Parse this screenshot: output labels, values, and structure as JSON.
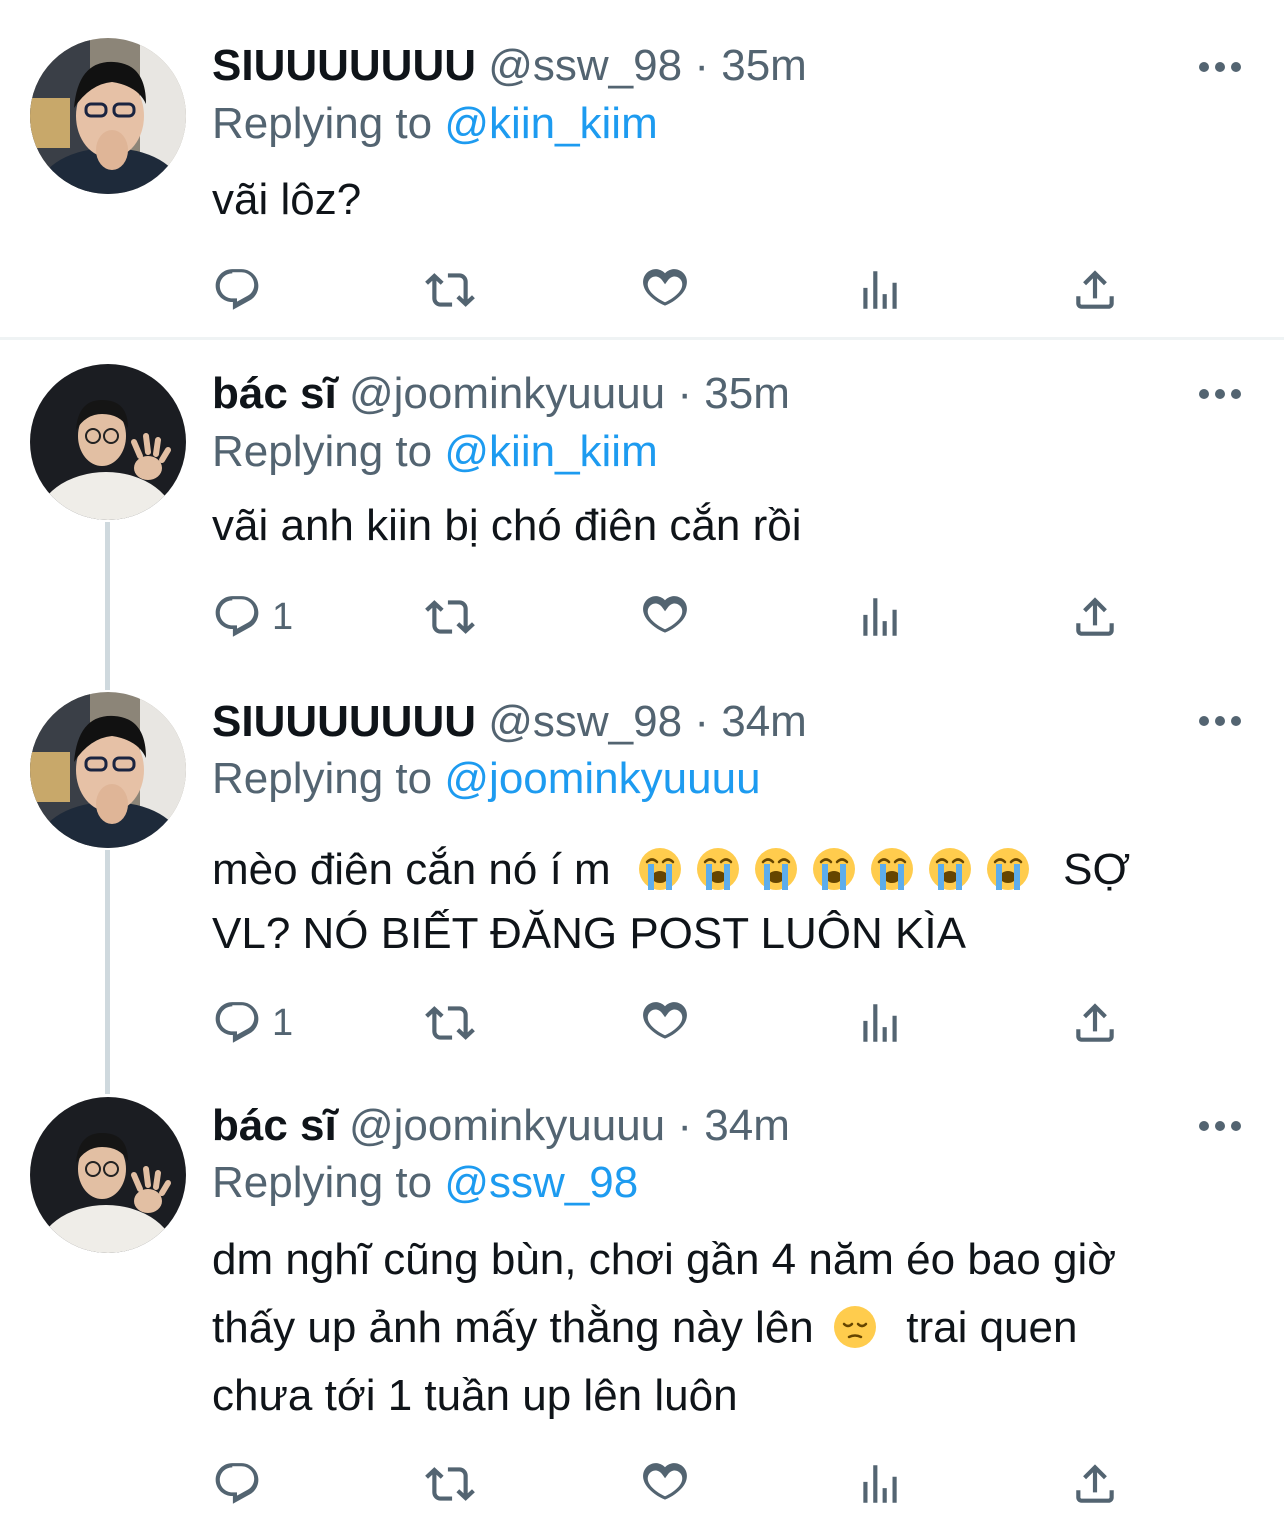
{
  "tweets": [
    {
      "display_name": "SIUUUUUUU",
      "handle": "@ssw_98",
      "separator": "·",
      "time": "35m",
      "replying_label": "Replying to",
      "replying_to": "@kiin_kiim",
      "text": "vãi lôz?",
      "reply_count": ""
    },
    {
      "display_name": "bác sĩ",
      "handle": "@joominkyuuuu",
      "separator": "·",
      "time": "35m",
      "replying_label": "Replying to",
      "replying_to": "@kiin_kiim",
      "text": "vãi anh kiin bị chó điên cắn rồi",
      "reply_count": "1"
    },
    {
      "display_name": "SIUUUUUUU",
      "handle": "@ssw_98",
      "separator": "·",
      "time": "34m",
      "replying_label": "Replying to",
      "replying_to": "@joominkyuuuu",
      "text_line1_prefix": "mèo điên cắn nó í m",
      "text_line1_suffix": "SỢ",
      "text_line2": "VL? NÓ BIẾT ĐĂNG POST LUÔN KÌA",
      "reply_count": "1"
    },
    {
      "display_name": "bác sĩ",
      "handle": "@joominkyuuuu",
      "separator": "·",
      "time": "34m",
      "replying_label": "Replying to",
      "replying_to": "@ssw_98",
      "text_line1": "dm nghĩ cũng bùn, chơi gần 4 năm éo bao giờ",
      "text_line2_prefix": "thấy up ảnh mấy thằng này lên",
      "text_line2_suffix": "trai quen",
      "text_line3": "chưa tới 1 tuần up lên luôn",
      "reply_count": ""
    }
  ],
  "icons": {
    "reply": "reply-icon",
    "retweet": "retweet-icon",
    "like": "heart-icon",
    "views": "views-icon",
    "share": "share-icon",
    "more": "more-options-icon",
    "crying_emoji": "loudly-crying-face-emoji",
    "pensive_emoji": "pensive-face-emoji"
  },
  "colors": {
    "text_primary": "#0f1419",
    "text_secondary": "#536471",
    "link": "#1d9bf0",
    "thread_line": "#cfd9de",
    "divider": "#eff3f4"
  }
}
